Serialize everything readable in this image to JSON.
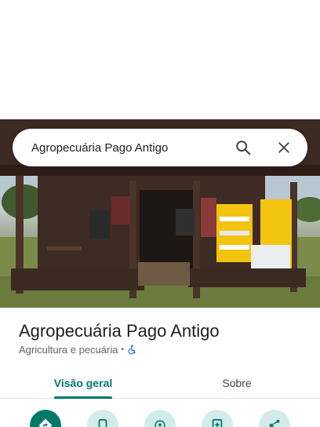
{
  "search": {
    "query": "Agropecuária Pago Antigo",
    "search_icon": "search-icon",
    "close_icon": "close-icon"
  },
  "place": {
    "name": "Agropecuária Pago Antigo",
    "category": "Agricultura e pecuária",
    "separator": "•",
    "accessibility_icon": "wheelchair-icon"
  },
  "tabs": [
    {
      "label": "Visão geral",
      "active": true
    },
    {
      "label": "Sobre",
      "active": false
    }
  ],
  "actions": [
    {
      "icon": "directions-icon"
    },
    {
      "icon": "phone-icon"
    },
    {
      "icon": "location-icon"
    },
    {
      "icon": "save-icon"
    },
    {
      "icon": "share-icon"
    }
  ],
  "colors": {
    "accent": "#00796b",
    "accent_light": "#d3ecea",
    "text_secondary": "#5f6368"
  }
}
